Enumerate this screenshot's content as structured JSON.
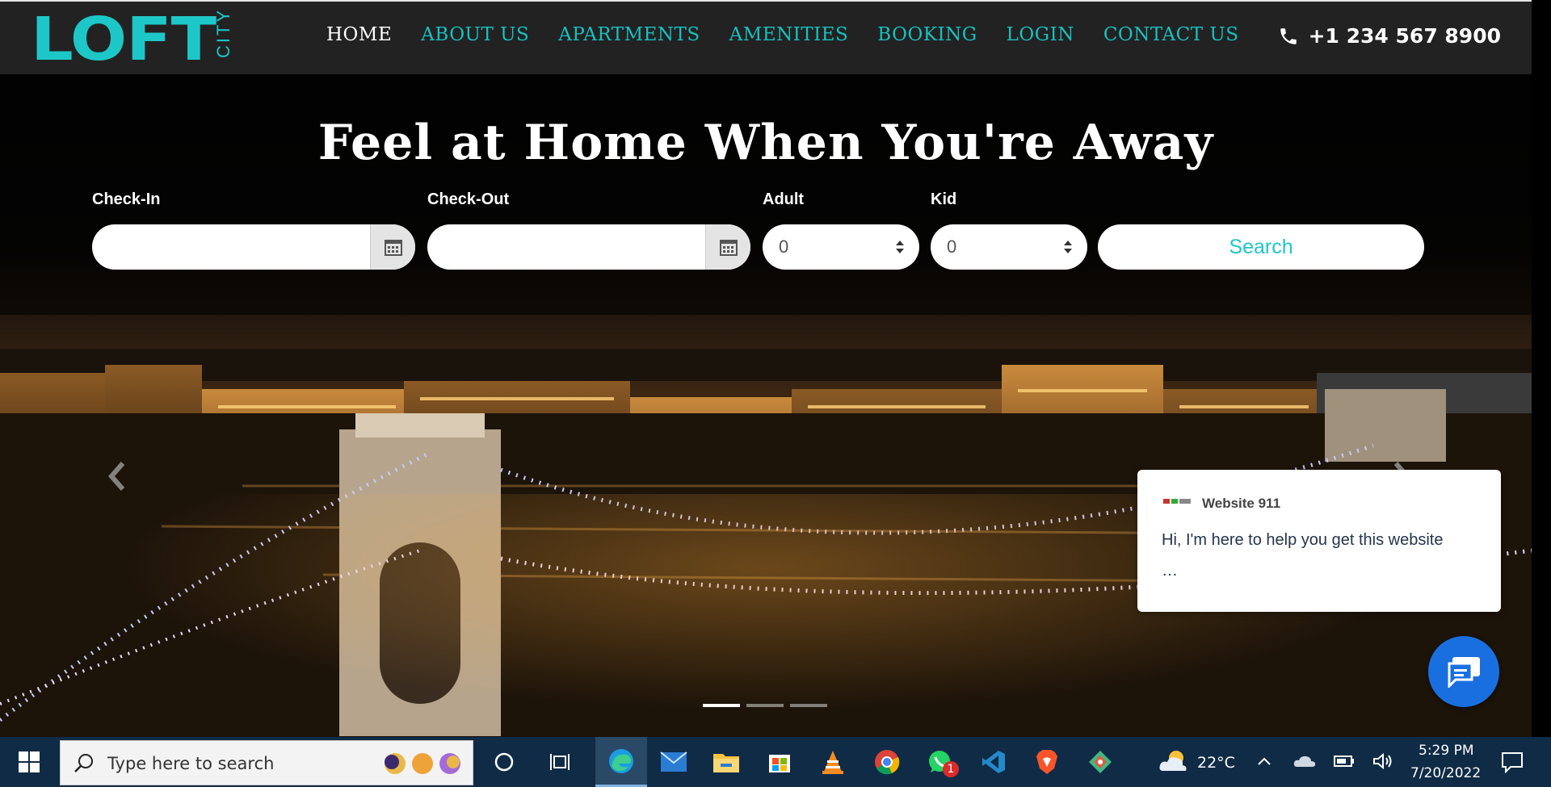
{
  "header": {
    "logo_main": "LOFT",
    "logo_sub": "CITY",
    "nav": [
      "HOME",
      "ABOUT US",
      "APARTMENTS",
      "AMENITIES",
      "BOOKING",
      "LOGIN",
      "CONTACT US"
    ],
    "phone": "+1 234 567 8900"
  },
  "hero": {
    "title": "Feel at Home When You're Away",
    "checkin_label": "Check-In",
    "checkout_label": "Check-Out",
    "adult_label": "Adult",
    "kid_label": "Kid",
    "adult_value": "0",
    "kid_value": "0",
    "search_label": "Search",
    "slides": 3,
    "active_slide": 1
  },
  "chat": {
    "name": "Website 911",
    "message": "Hi, I'm here to help you get this website",
    "more": "…"
  },
  "taskbar": {
    "search_placeholder": "Type here to search",
    "weather": "22°C",
    "time": "5:29 PM",
    "date": "7/20/2022",
    "whatsapp_badge": "1"
  },
  "colors": {
    "accent": "#1ec7c7",
    "navbar": "#222222",
    "taskbar": "#0f2b46",
    "chat_button": "#1a6fe0"
  }
}
